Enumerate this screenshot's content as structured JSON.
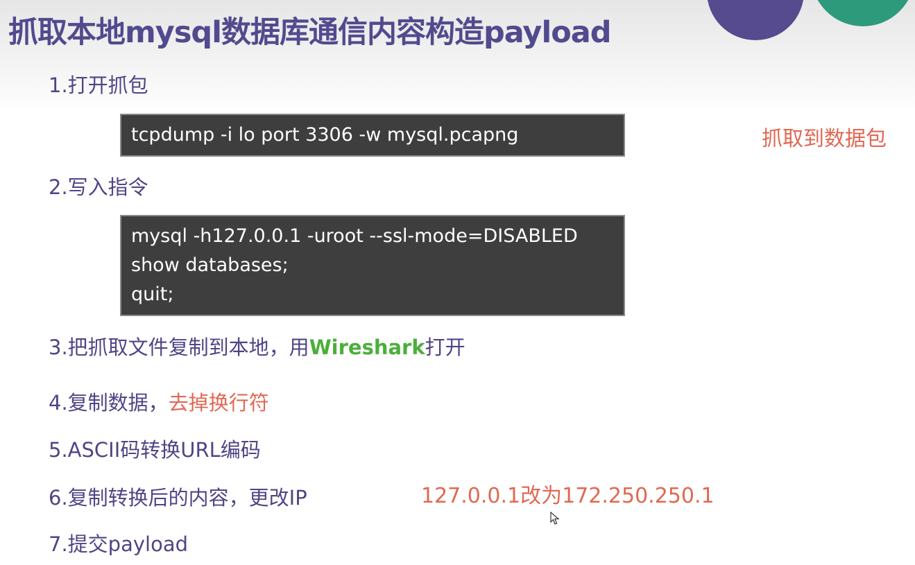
{
  "slide": {
    "title": "抓取本地mysql数据库通信内容构造payload"
  },
  "steps": [
    {
      "number": "1.",
      "text": "打开抓包"
    },
    {
      "number": "2.",
      "text": "写入指令"
    },
    {
      "number": "3.",
      "text_before": "把抓取文件复制到本地，用",
      "highlight": "Wireshark",
      "text_after": "打开"
    },
    {
      "number": "4.",
      "text": "复制数据，",
      "highlight": "去掉换行符"
    },
    {
      "number": "5.",
      "text": "ASCII码转换URL编码"
    },
    {
      "number": "6.",
      "text": "复制转换后的内容，更改IP"
    },
    {
      "number": "7.",
      "text": "提交payload"
    }
  ],
  "code_blocks": [
    {
      "lines": [
        "tcpdump -i lo port 3306 -w mysql.pcapng"
      ]
    },
    {
      "lines": [
        "mysql -h127.0.0.1 -uroot --ssl-mode=DISABLED",
        "show databases;",
        "quit;"
      ]
    }
  ],
  "notes": {
    "capture": "抓取到数据包",
    "ip_change": "127.0.0.1改为172.250.250.1"
  },
  "colors": {
    "title": "#524a8e",
    "step_text": "#4f4585",
    "highlight_green": "#4caf3b",
    "highlight_red": "#e06852",
    "code_background": "#3e3e3e",
    "deco_purple": "#564b8f",
    "deco_green": "#2e9a7c"
  },
  "icons": {
    "cursor": "mouse-pointer-icon"
  }
}
